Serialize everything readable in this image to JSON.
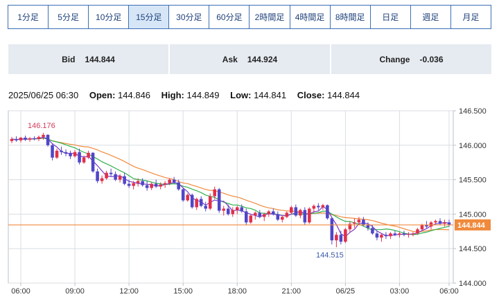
{
  "timeframes": [
    {
      "label": "1分足"
    },
    {
      "label": "5分足"
    },
    {
      "label": "10分足"
    },
    {
      "label": "15分足",
      "active": true
    },
    {
      "label": "30分足"
    },
    {
      "label": "60分足"
    },
    {
      "label": "2時間足"
    },
    {
      "label": "4時間足"
    },
    {
      "label": "8時間足"
    },
    {
      "label": "日足"
    },
    {
      "label": "週足"
    },
    {
      "label": "月足"
    }
  ],
  "quotes": {
    "bid_label": "Bid",
    "bid": "144.844",
    "ask_label": "Ask",
    "ask": "144.924",
    "change_label": "Change",
    "change": "-0.036"
  },
  "ohlc": {
    "datetime": "2025/06/25 06:30",
    "open_label": "Open:",
    "open": "144.846",
    "high_label": "High:",
    "high": "144.849",
    "low_label": "Low:",
    "low": "144.841",
    "close_label": "Close:",
    "close": "144.844"
  },
  "colors": {
    "up": "#e0304a",
    "down": "#4f46c8",
    "ma_short": "#7a3cc8",
    "ma_mid": "#2db04a",
    "ma_long": "#f08a3c",
    "price_line": "#f08a3c",
    "grid": "#d8dde3",
    "axis": "#b8c0c8"
  },
  "chart_data": {
    "type": "candlestick",
    "ylim": [
      144.0,
      146.5
    ],
    "y_ticks": [
      "146.500",
      "146.000",
      "145.500",
      "145.000",
      "144.500",
      "144.000"
    ],
    "x_ticks": [
      "06:00",
      "09:00",
      "12:00",
      "15:00",
      "18:00",
      "21:00",
      "06/25",
      "03:00",
      "06:00"
    ],
    "current_price": "144.844",
    "high_annotation": "146.176",
    "low_annotation": "144.515",
    "candles": [
      [
        146.06,
        146.12,
        146.03,
        146.09
      ],
      [
        146.09,
        146.13,
        146.05,
        146.07
      ],
      [
        146.07,
        146.12,
        146.04,
        146.11
      ],
      [
        146.11,
        146.14,
        146.06,
        146.08
      ],
      [
        146.08,
        146.12,
        146.05,
        146.1
      ],
      [
        146.1,
        146.13,
        146.07,
        146.09
      ],
      [
        146.09,
        146.14,
        146.06,
        146.12
      ],
      [
        146.12,
        146.18,
        146.08,
        146.15
      ],
      [
        146.15,
        146.16,
        145.98,
        146.0
      ],
      [
        146.0,
        146.02,
        145.78,
        145.82
      ],
      [
        145.82,
        145.95,
        145.8,
        145.92
      ],
      [
        145.92,
        145.98,
        145.86,
        145.9
      ],
      [
        145.9,
        145.94,
        145.84,
        145.88
      ],
      [
        145.88,
        145.92,
        145.8,
        145.84
      ],
      [
        145.84,
        145.93,
        145.82,
        145.9
      ],
      [
        145.9,
        145.95,
        145.72,
        145.75
      ],
      [
        145.75,
        145.85,
        145.73,
        145.82
      ],
      [
        145.82,
        145.92,
        145.8,
        145.89
      ],
      [
        145.89,
        145.9,
        145.6,
        145.62
      ],
      [
        145.62,
        145.66,
        145.45,
        145.48
      ],
      [
        145.48,
        145.56,
        145.44,
        145.52
      ],
      [
        145.52,
        145.63,
        145.5,
        145.6
      ],
      [
        145.6,
        145.66,
        145.55,
        145.58
      ],
      [
        145.58,
        145.62,
        145.48,
        145.5
      ],
      [
        145.5,
        145.58,
        145.46,
        145.55
      ],
      [
        145.55,
        145.6,
        145.42,
        145.44
      ],
      [
        145.44,
        145.5,
        145.38,
        145.41
      ],
      [
        145.41,
        145.48,
        145.36,
        145.45
      ],
      [
        145.45,
        145.52,
        145.4,
        145.48
      ],
      [
        145.48,
        145.52,
        145.4,
        145.42
      ],
      [
        145.42,
        145.48,
        145.34,
        145.38
      ],
      [
        145.38,
        145.46,
        145.35,
        145.44
      ],
      [
        145.44,
        145.5,
        145.38,
        145.4
      ],
      [
        145.4,
        145.46,
        145.36,
        145.43
      ],
      [
        145.43,
        145.48,
        145.38,
        145.45
      ],
      [
        145.45,
        145.52,
        145.42,
        145.5
      ],
      [
        145.5,
        145.54,
        145.44,
        145.46
      ],
      [
        145.46,
        145.5,
        145.34,
        145.36
      ],
      [
        145.36,
        145.38,
        145.18,
        145.2
      ],
      [
        145.2,
        145.3,
        145.18,
        145.28
      ],
      [
        145.28,
        145.3,
        145.08,
        145.1
      ],
      [
        145.1,
        145.24,
        145.06,
        145.22
      ],
      [
        145.22,
        145.26,
        145.1,
        145.12
      ],
      [
        145.12,
        145.18,
        145.04,
        145.08
      ],
      [
        145.08,
        145.3,
        145.06,
        145.26
      ],
      [
        145.26,
        145.4,
        145.22,
        145.36
      ],
      [
        145.36,
        145.38,
        145.02,
        145.05
      ],
      [
        145.05,
        145.12,
        144.98,
        145.08
      ],
      [
        145.08,
        145.14,
        144.98,
        145.0
      ],
      [
        145.0,
        145.1,
        144.96,
        145.06
      ],
      [
        145.06,
        145.12,
        145.0,
        145.1
      ],
      [
        145.1,
        145.14,
        145.02,
        145.04
      ],
      [
        145.04,
        145.08,
        144.84,
        144.88
      ],
      [
        144.88,
        145.0,
        144.86,
        144.98
      ],
      [
        144.98,
        145.04,
        144.92,
        145.02
      ],
      [
        145.02,
        145.06,
        144.94,
        144.96
      ],
      [
        144.96,
        145.02,
        144.9,
        145.0
      ],
      [
        145.0,
        145.06,
        144.96,
        145.04
      ],
      [
        145.04,
        145.08,
        144.98,
        145.0
      ],
      [
        145.0,
        145.04,
        144.9,
        144.92
      ],
      [
        144.92,
        144.98,
        144.88,
        144.96
      ],
      [
        144.96,
        145.04,
        144.94,
        145.02
      ],
      [
        145.02,
        145.12,
        145.0,
        145.1
      ],
      [
        145.1,
        145.14,
        144.96,
        144.98
      ],
      [
        144.98,
        145.08,
        144.94,
        145.06
      ],
      [
        145.06,
        145.1,
        144.84,
        144.88
      ],
      [
        144.88,
        145.1,
        144.86,
        145.08
      ],
      [
        145.08,
        145.14,
        145.02,
        145.12
      ],
      [
        145.12,
        145.16,
        145.06,
        145.1
      ],
      [
        145.1,
        145.15,
        145.06,
        145.13
      ],
      [
        145.13,
        145.14,
        144.92,
        144.94
      ],
      [
        144.94,
        144.96,
        144.56,
        144.62
      ],
      [
        144.62,
        144.74,
        144.52,
        144.7
      ],
      [
        144.7,
        144.76,
        144.56,
        144.6
      ],
      [
        144.6,
        144.8,
        144.58,
        144.78
      ],
      [
        144.78,
        144.9,
        144.74,
        144.86
      ],
      [
        144.86,
        144.94,
        144.8,
        144.88
      ],
      [
        144.88,
        144.96,
        144.84,
        144.92
      ],
      [
        144.92,
        144.96,
        144.82,
        144.84
      ],
      [
        144.84,
        144.88,
        144.76,
        144.8
      ],
      [
        144.8,
        144.84,
        144.7,
        144.72
      ],
      [
        144.72,
        144.76,
        144.62,
        144.66
      ],
      [
        144.66,
        144.72,
        144.6,
        144.7
      ],
      [
        144.7,
        144.74,
        144.64,
        144.68
      ],
      [
        144.68,
        144.74,
        144.64,
        144.72
      ],
      [
        144.72,
        144.76,
        144.68,
        144.7
      ],
      [
        144.7,
        144.74,
        144.66,
        144.72
      ],
      [
        144.72,
        144.76,
        144.68,
        144.7
      ],
      [
        144.7,
        144.74,
        144.66,
        144.71
      ],
      [
        144.71,
        144.74,
        144.68,
        144.72
      ],
      [
        144.72,
        144.8,
        144.7,
        144.78
      ],
      [
        144.78,
        144.86,
        144.76,
        144.84
      ],
      [
        144.84,
        144.9,
        144.8,
        144.82
      ],
      [
        144.82,
        144.9,
        144.78,
        144.88
      ],
      [
        144.88,
        144.92,
        144.84,
        144.9
      ],
      [
        144.9,
        144.94,
        144.84,
        144.86
      ],
      [
        144.86,
        144.92,
        144.82,
        144.88
      ],
      [
        144.88,
        144.92,
        144.82,
        144.84
      ]
    ]
  }
}
